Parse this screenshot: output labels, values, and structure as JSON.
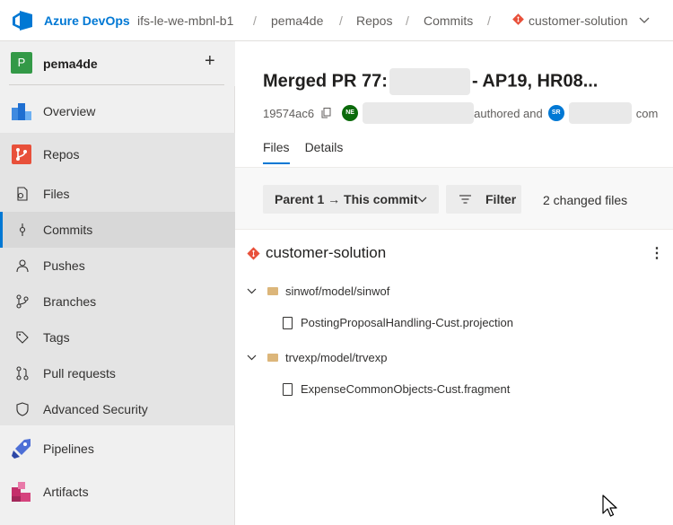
{
  "topbar": {
    "brand": "Azure DevOps",
    "breadcrumbs": [
      "ifs-le-we-mbnl-b1",
      "pema4de",
      "Repos",
      "Commits",
      "customer-solution"
    ],
    "separator": "/"
  },
  "sidebar": {
    "project": {
      "initial": "P",
      "name": "pema4de",
      "add_label": "+"
    },
    "items": [
      {
        "label": "Overview",
        "icon": "overview-icon"
      },
      {
        "label": "Repos",
        "icon": "repos-icon"
      },
      {
        "label": "Files",
        "icon": "files-icon"
      },
      {
        "label": "Commits",
        "icon": "commits-icon",
        "selected": true
      },
      {
        "label": "Pushes",
        "icon": "pushes-icon"
      },
      {
        "label": "Branches",
        "icon": "branches-icon"
      },
      {
        "label": "Tags",
        "icon": "tags-icon"
      },
      {
        "label": "Pull requests",
        "icon": "pull-requests-icon"
      },
      {
        "label": "Advanced Security",
        "icon": "shield-icon"
      },
      {
        "label": "Pipelines",
        "icon": "pipelines-icon"
      },
      {
        "label": "Artifacts",
        "icon": "artifacts-icon"
      }
    ]
  },
  "main": {
    "title_prefix": "Merged PR 77:",
    "title_suffix": "- AP19, HR08...",
    "commit_id": "19574ac6",
    "author_initials": "NE",
    "authored_text": "authored and",
    "committer_initials": "SR",
    "trailing_text": "com",
    "tabs": [
      {
        "label": "Files",
        "active": true
      },
      {
        "label": "Details",
        "active": false
      }
    ],
    "toolbar": {
      "compare_label": "Parent 1 → This commit",
      "filter_label": "Filter",
      "changed_files": "2 changed files"
    },
    "repo_name": "customer-solution",
    "tree": [
      {
        "folder": "sinwof/model/sinwof",
        "files": [
          "PostingProposalHandling-Cust.projection"
        ]
      },
      {
        "folder": "trvexp/model/trvexp",
        "files": [
          "ExpenseCommonObjects-Cust.fragment"
        ]
      }
    ]
  },
  "colors": {
    "accent": "#0078d4",
    "project_avatar": "#339947",
    "git_repo": "#e8503a",
    "author_avatar": "#0b6a0b",
    "committer_avatar": "#0078d4"
  }
}
